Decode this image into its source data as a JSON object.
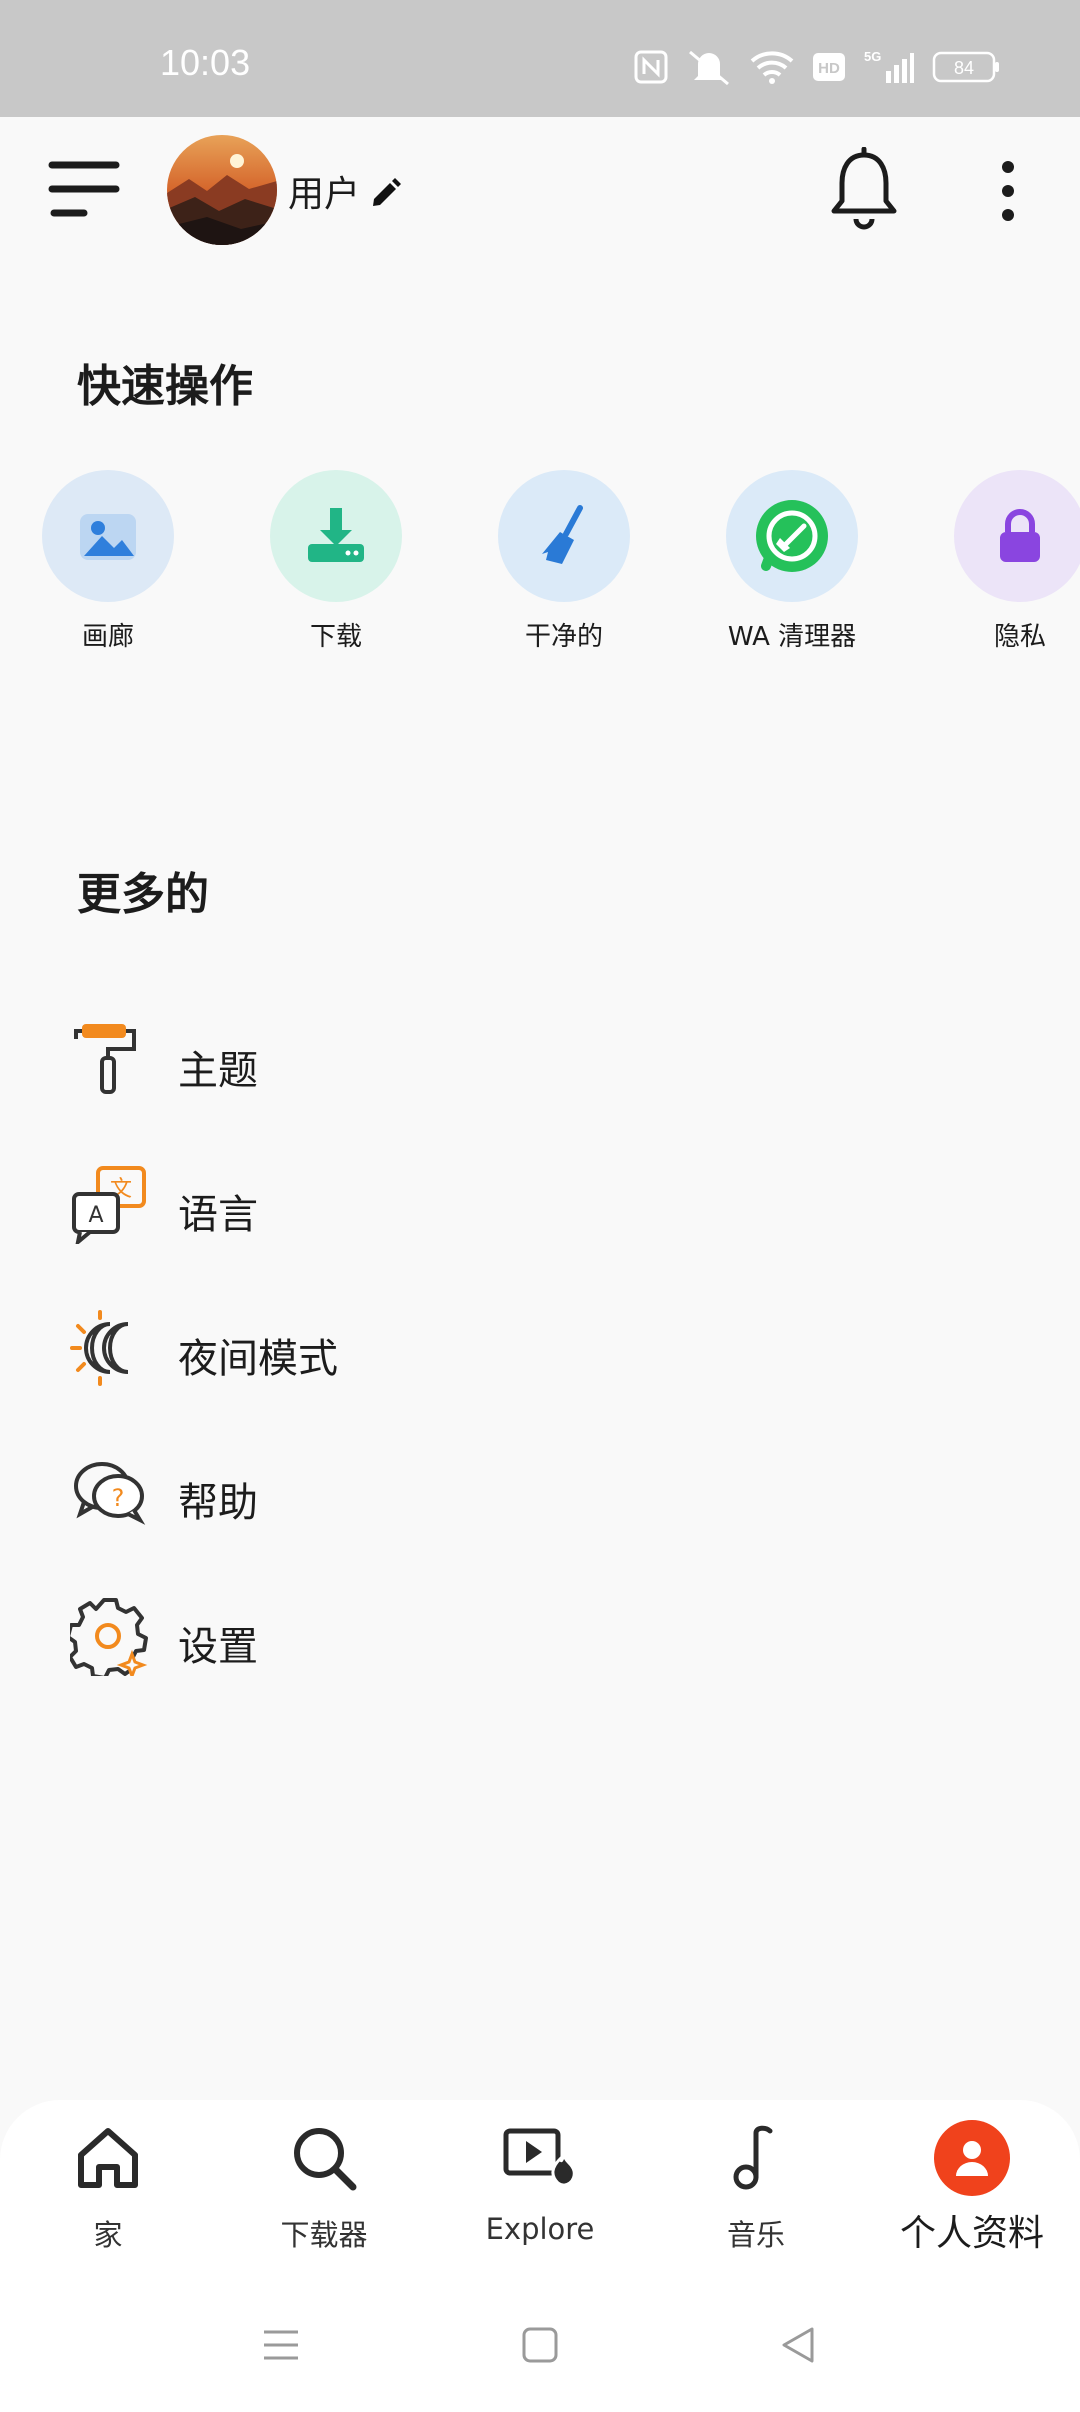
{
  "status_bar": {
    "time": "10:03",
    "battery": "84"
  },
  "header": {
    "username": "用户"
  },
  "quick_actions": {
    "title": "快速操作",
    "items": [
      {
        "label": "画廊",
        "icon": "gallery-icon"
      },
      {
        "label": "下载",
        "icon": "download-icon"
      },
      {
        "label": "干净的",
        "icon": "broom-icon"
      },
      {
        "label": "WA 清理器",
        "icon": "whatsapp-cleaner-icon"
      },
      {
        "label": "隐私",
        "icon": "lock-icon"
      }
    ]
  },
  "more": {
    "title": "更多的",
    "items": [
      {
        "label": "主题",
        "icon": "paint-roller-icon"
      },
      {
        "label": "语言",
        "icon": "translate-icon"
      },
      {
        "label": "夜间模式",
        "icon": "night-mode-icon"
      },
      {
        "label": "帮助",
        "icon": "help-icon"
      },
      {
        "label": "设置",
        "icon": "settings-icon"
      }
    ]
  },
  "bottom_nav": {
    "items": [
      {
        "label": "家",
        "icon": "home-icon"
      },
      {
        "label": "下载器",
        "icon": "search-icon"
      },
      {
        "label": "Explore",
        "icon": "explore-video-icon"
      },
      {
        "label": "音乐",
        "icon": "music-note-icon"
      },
      {
        "label": "个人资料",
        "icon": "profile-icon",
        "active": true
      }
    ]
  },
  "colors": {
    "accent": "#f0421c",
    "orange_icon": "#f28a1e",
    "background": "#f9f9f9"
  }
}
